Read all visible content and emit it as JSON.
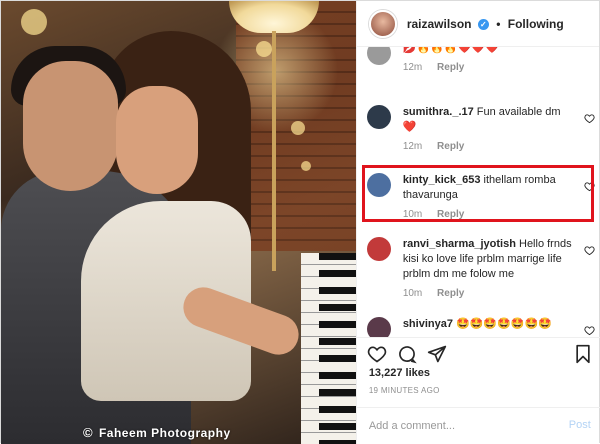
{
  "photo": {
    "watermark": "Faheem Photography",
    "copyright_symbol": "©"
  },
  "header": {
    "username": "raizawilson",
    "separator": "•",
    "follow_state": "Following"
  },
  "comments": [
    {
      "username": "",
      "text": "💋🔥🔥🔥❤️❤️❤️",
      "time": "12m",
      "reply_label": "Reply",
      "avatar_color": "#9a9a9a"
    },
    {
      "username": "sumithra._.17",
      "text": "Fun available dm ❤️",
      "time": "12m",
      "reply_label": "Reply",
      "avatar_color": "#2d3a4a"
    },
    {
      "username": "kinty_kick_653",
      "text": "ithellam romba thavarunga",
      "time": "10m",
      "reply_label": "Reply",
      "avatar_color": "#4d6fa0"
    },
    {
      "username": "ranvi_sharma_jyotish",
      "text": "Hello frnds kisi ko love life prblm marrige life prblm dm me folow me",
      "time": "10m",
      "reply_label": "Reply",
      "avatar_color": "#c23a3a"
    },
    {
      "username": "shivinya7",
      "text": "🤩🤩🤩🤩🤩🤩🤩",
      "time": "",
      "reply_label": "",
      "avatar_color": "#5a3a4a"
    }
  ],
  "actions": {
    "icons": [
      "heart-icon",
      "comment-icon",
      "share-icon",
      "bookmark-icon"
    ]
  },
  "likes": {
    "text": "13,227 likes"
  },
  "posted": {
    "text": "19 MINUTES AGO"
  },
  "add_comment": {
    "placeholder": "Add a comment...",
    "post_label": "Post"
  },
  "colors": {
    "highlight": "#e0141d",
    "verified": "#3897f0",
    "post_disabled": "#b3d3f5"
  }
}
